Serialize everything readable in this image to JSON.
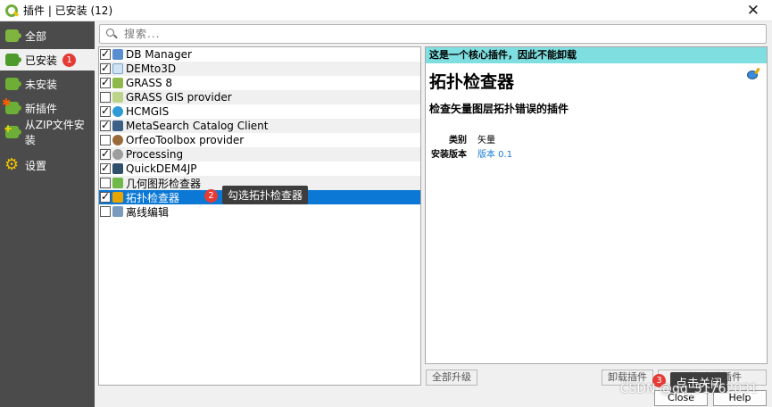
{
  "window": {
    "title": "插件 | 已安装 (12)",
    "close_glyph": "✕"
  },
  "sidebar": {
    "items": [
      {
        "label": "全部",
        "icon": "puzzle-icon",
        "active": false
      },
      {
        "label": "已安装",
        "icon": "puzzle-icon",
        "active": true,
        "badge": "1"
      },
      {
        "label": "未安装",
        "icon": "puzzle-icon",
        "active": false
      },
      {
        "label": "新插件",
        "icon": "puzzle-star-icon",
        "active": false
      },
      {
        "label": "从ZIP文件安装",
        "icon": "puzzle-plus-icon",
        "active": false
      },
      {
        "label": "设置",
        "icon": "gear-icon",
        "active": false
      }
    ]
  },
  "search": {
    "placeholder": "搜索...",
    "value": ""
  },
  "plugins": [
    {
      "name": "DB Manager",
      "checked": true
    },
    {
      "name": "DEMto3D",
      "checked": true
    },
    {
      "name": "GRASS 8",
      "checked": true
    },
    {
      "name": "GRASS GIS provider",
      "checked": false
    },
    {
      "name": "HCMGIS",
      "checked": true
    },
    {
      "name": "MetaSearch Catalog Client",
      "checked": true
    },
    {
      "name": "OrfeoToolbox provider",
      "checked": false
    },
    {
      "name": "Processing",
      "checked": true
    },
    {
      "name": "QuickDEM4JP",
      "checked": true
    },
    {
      "name": "几何图形检查器",
      "checked": false
    },
    {
      "name": "拓扑检查器",
      "checked": true,
      "selected": true
    },
    {
      "name": "离线编辑",
      "checked": false
    }
  ],
  "annotations": {
    "step2_num": "2",
    "step2_text": "勾选拓扑检查器",
    "step3_num": "3",
    "step3_text": "点击关闭"
  },
  "detail": {
    "core_notice": "这是一个核心插件，因此不能卸载",
    "title": "拓扑检查器",
    "description": "检查矢量图层拓扑错误的插件",
    "category_label": "类别",
    "category_value": "矢量",
    "version_label": "安装版本",
    "version_value": "版本 0.1"
  },
  "buttons": {
    "upgrade_all": "全部升级",
    "uninstall": "卸载插件",
    "reinstall": "重新安装插件",
    "close": "Close",
    "help": "Help"
  },
  "watermark": "CSDN @qq_31762031",
  "colors": {
    "sidebar_bg": "#4b4b4b",
    "selection": "#0b78d6",
    "core_notice_bg": "#7fdfe0",
    "badge_red": "#e43b35"
  }
}
